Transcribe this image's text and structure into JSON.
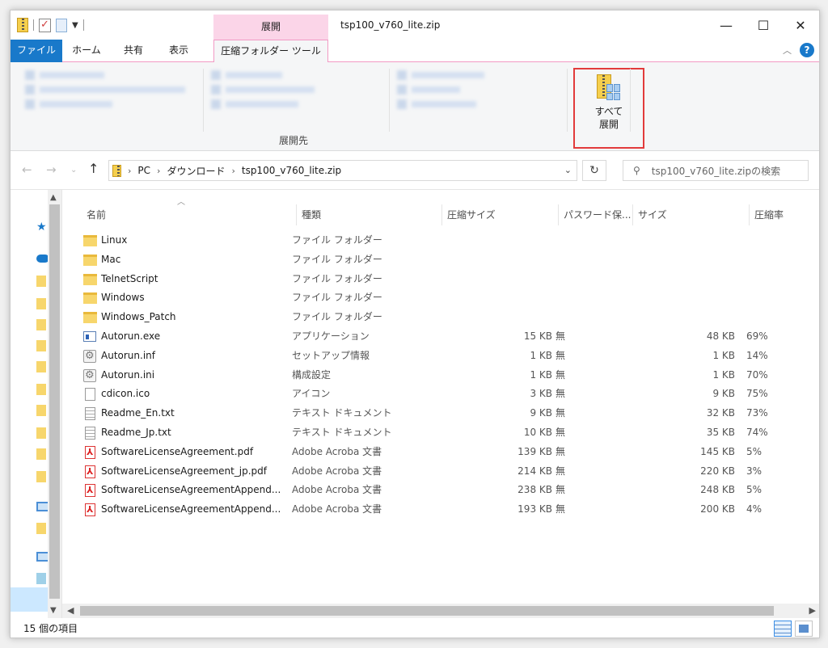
{
  "window": {
    "title": "tsp100_v760_lite.zip",
    "context_tab_header": "展開"
  },
  "ribbon_tabs": {
    "file": "ファイル",
    "home": "ホーム",
    "share": "共有",
    "view": "表示",
    "compressed_tools": "圧縮フォルダー ツール"
  },
  "ribbon": {
    "group_label": "展開先",
    "extract_all_line1": "すべて",
    "extract_all_line2": "展開"
  },
  "address": {
    "crumbs": [
      "PC",
      "ダウンロード",
      "tsp100_v760_lite.zip"
    ],
    "search_placeholder": "tsp100_v760_lite.zipの検索"
  },
  "columns": {
    "name": "名前",
    "type": "種類",
    "compressed_size": "圧縮サイズ",
    "password": "パスワード保...",
    "size": "サイズ",
    "ratio": "圧縮率"
  },
  "files": [
    {
      "name": "Linux",
      "type": "ファイル フォルダー",
      "icon": "folder-icon",
      "csize": "",
      "pw": "",
      "size": "",
      "ratio": ""
    },
    {
      "name": "Mac",
      "type": "ファイル フォルダー",
      "icon": "folder-icon",
      "csize": "",
      "pw": "",
      "size": "",
      "ratio": ""
    },
    {
      "name": "TelnetScript",
      "type": "ファイル フォルダー",
      "icon": "folder-icon",
      "csize": "",
      "pw": "",
      "size": "",
      "ratio": ""
    },
    {
      "name": "Windows",
      "type": "ファイル フォルダー",
      "icon": "folder-icon",
      "csize": "",
      "pw": "",
      "size": "",
      "ratio": ""
    },
    {
      "name": "Windows_Patch",
      "type": "ファイル フォルダー",
      "icon": "folder-icon",
      "csize": "",
      "pw": "",
      "size": "",
      "ratio": ""
    },
    {
      "name": "Autorun.exe",
      "type": "アプリケーション",
      "icon": "exe-icon",
      "csize": "15 KB",
      "pw": "無",
      "size": "48 KB",
      "ratio": "69%"
    },
    {
      "name": "Autorun.inf",
      "type": "セットアップ情報",
      "icon": "settings-file-icon",
      "csize": "1 KB",
      "pw": "無",
      "size": "1 KB",
      "ratio": "14%"
    },
    {
      "name": "Autorun.ini",
      "type": "構成設定",
      "icon": "settings-file-icon",
      "csize": "1 KB",
      "pw": "無",
      "size": "1 KB",
      "ratio": "70%"
    },
    {
      "name": "cdicon.ico",
      "type": "アイコン",
      "icon": "document-icon",
      "csize": "3 KB",
      "pw": "無",
      "size": "9 KB",
      "ratio": "75%"
    },
    {
      "name": "Readme_En.txt",
      "type": "テキスト ドキュメント",
      "icon": "text-file-icon",
      "csize": "9 KB",
      "pw": "無",
      "size": "32 KB",
      "ratio": "73%"
    },
    {
      "name": "Readme_Jp.txt",
      "type": "テキスト ドキュメント",
      "icon": "text-file-icon",
      "csize": "10 KB",
      "pw": "無",
      "size": "35 KB",
      "ratio": "74%"
    },
    {
      "name": "SoftwareLicenseAgreement.pdf",
      "type": "Adobe Acroba 文書",
      "icon": "pdf-icon",
      "csize": "139 KB",
      "pw": "無",
      "size": "145 KB",
      "ratio": "5%"
    },
    {
      "name": "SoftwareLicenseAgreement_jp.pdf",
      "type": "Adobe Acroba 文書",
      "icon": "pdf-icon",
      "csize": "214 KB",
      "pw": "無",
      "size": "220 KB",
      "ratio": "3%"
    },
    {
      "name": "SoftwareLicenseAgreementAppend...",
      "type": "Adobe Acroba 文書",
      "icon": "pdf-icon",
      "csize": "238 KB",
      "pw": "無",
      "size": "248 KB",
      "ratio": "5%"
    },
    {
      "name": "SoftwareLicenseAgreementAppend...",
      "type": "Adobe Acroba 文書",
      "icon": "pdf-icon",
      "csize": "193 KB",
      "pw": "無",
      "size": "200 KB",
      "ratio": "4%"
    }
  ],
  "status": {
    "item_count": "15 個の項目"
  },
  "colors": {
    "file_tab": "#1979ca",
    "context_tab": "#fbd5e8",
    "highlight_box": "#e23b3b"
  }
}
